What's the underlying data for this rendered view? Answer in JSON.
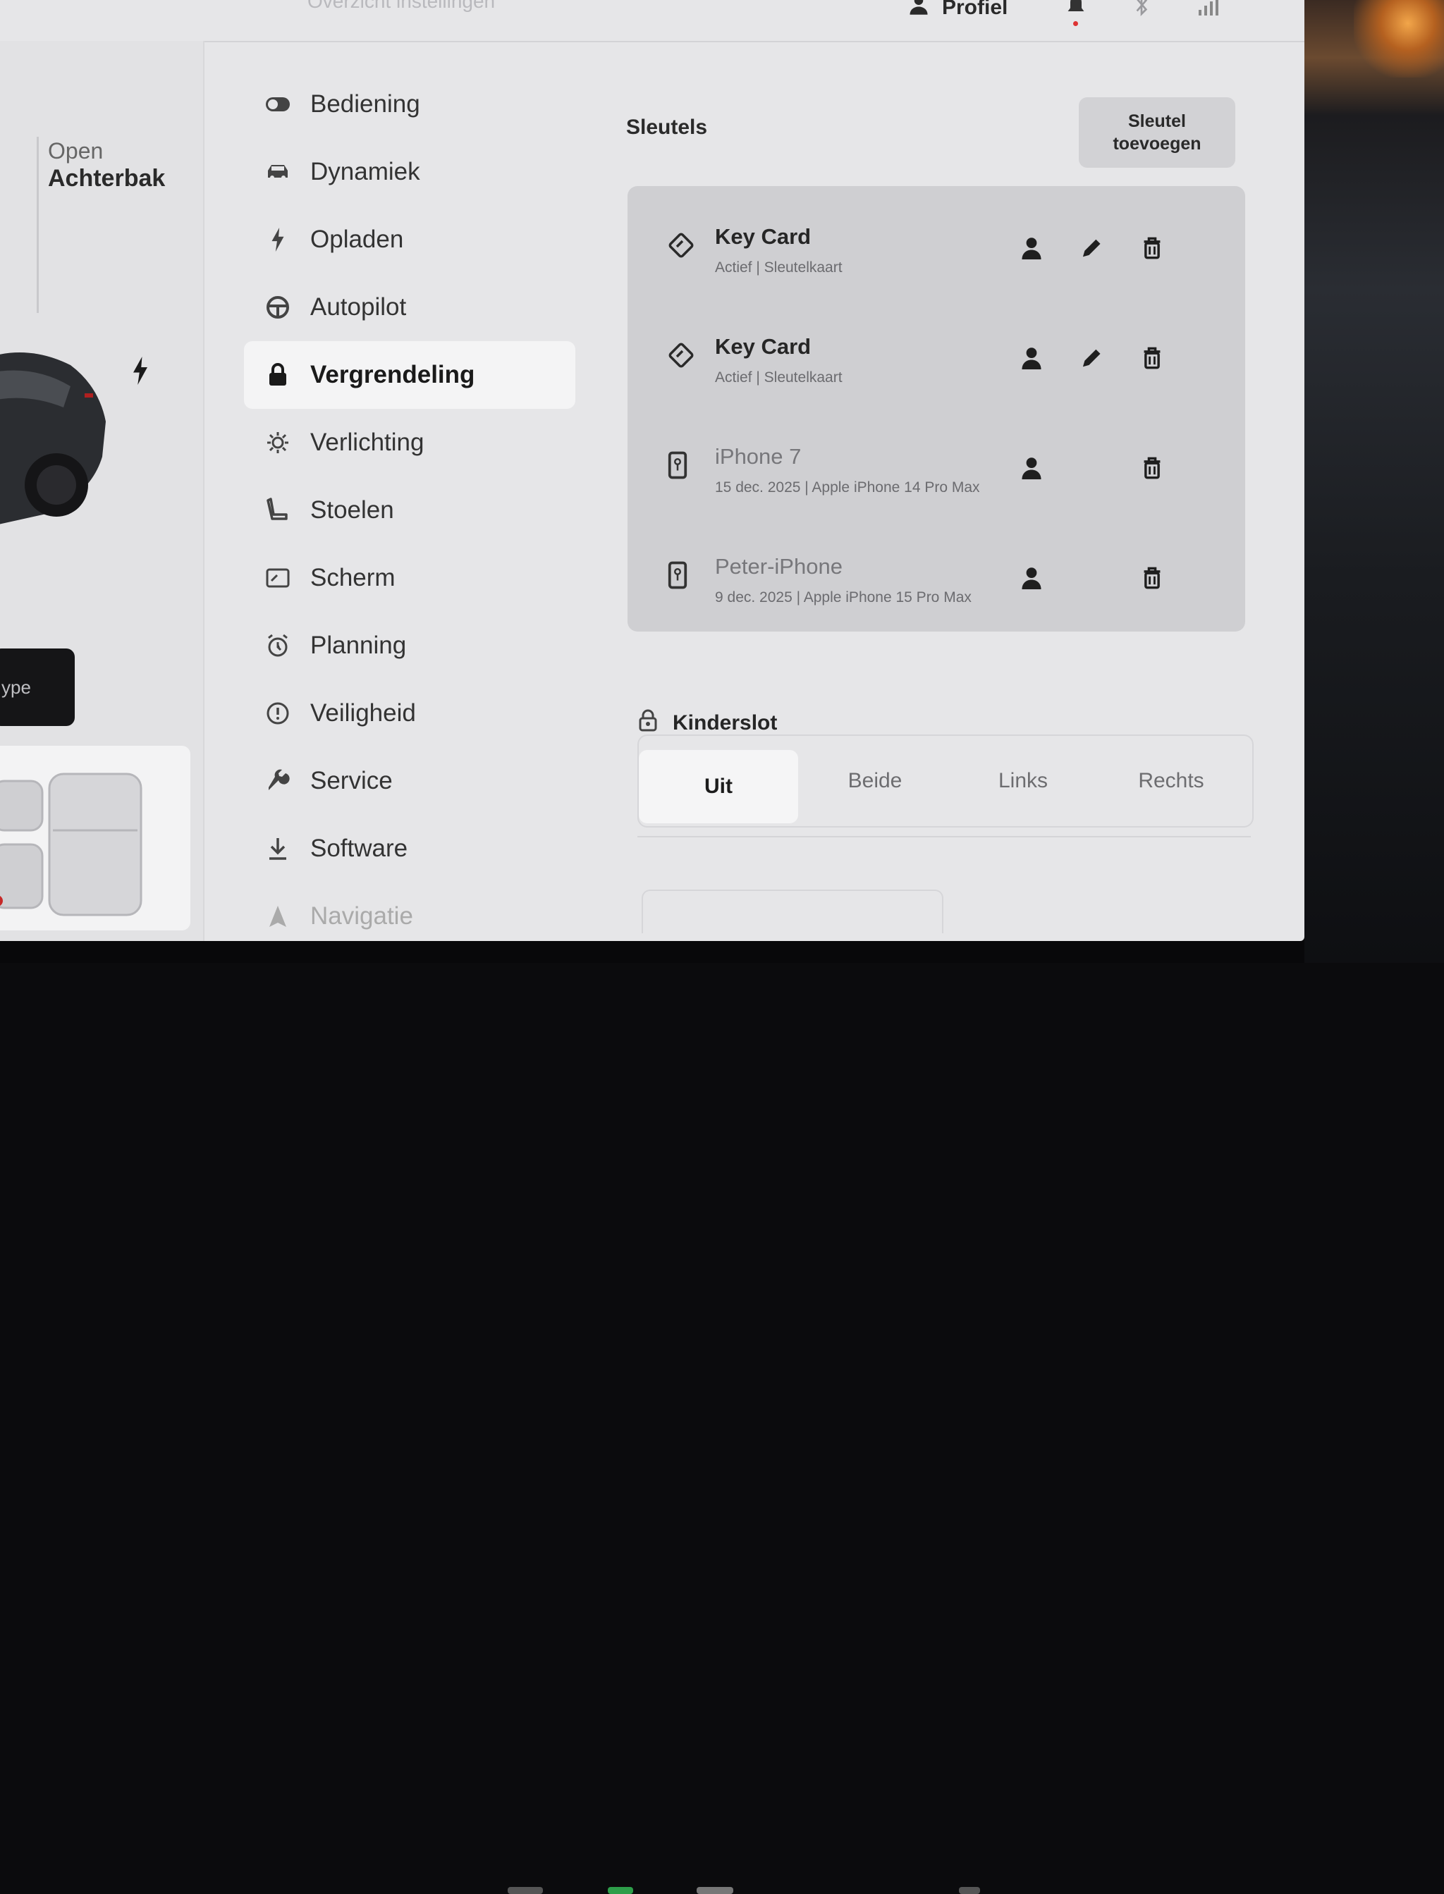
{
  "topbar": {
    "breadcrumb": "Overzicht instellingen",
    "profile_label": "Profiel"
  },
  "car_panel": {
    "open_label": "Open",
    "trunk_label": "Achterbak",
    "type_button_label": "ype"
  },
  "menu": {
    "items": [
      {
        "label": "Bediening",
        "icon": "toggle-icon"
      },
      {
        "label": "Dynamiek",
        "icon": "car-icon"
      },
      {
        "label": "Opladen",
        "icon": "bolt-icon"
      },
      {
        "label": "Autopilot",
        "icon": "steering-wheel-icon"
      },
      {
        "label": "Vergrendeling",
        "icon": "lock-icon",
        "active": true
      },
      {
        "label": "Verlichting",
        "icon": "light-icon"
      },
      {
        "label": "Stoelen",
        "icon": "seat-icon"
      },
      {
        "label": "Scherm",
        "icon": "display-icon"
      },
      {
        "label": "Planning",
        "icon": "alarm-clock-icon"
      },
      {
        "label": "Veiligheid",
        "icon": "alert-circle-icon"
      },
      {
        "label": "Service",
        "icon": "wrench-icon"
      },
      {
        "label": "Software",
        "icon": "download-icon"
      },
      {
        "label": "Navigatie",
        "icon": "navigation-icon"
      }
    ]
  },
  "keys": {
    "title": "Sleutels",
    "add_button_line1": "Sleutel",
    "add_button_line2": "toevoegen",
    "list": [
      {
        "name": "Key Card",
        "subtitle": "Actief | Sleutelkaart",
        "type": "keycard"
      },
      {
        "name": "Key Card",
        "subtitle": "Actief | Sleutelkaart",
        "type": "keycard"
      },
      {
        "name": "iPhone 7",
        "subtitle": "15 dec. 2025 | Apple iPhone 14 Pro Max",
        "type": "phone"
      },
      {
        "name": "Peter-iPhone",
        "subtitle": "9 dec. 2025 | Apple iPhone 15 Pro Max",
        "type": "phone"
      }
    ]
  },
  "child_lock": {
    "title": "Kinderslot",
    "options": [
      "Uit",
      "Beide",
      "Links",
      "Rechts"
    ],
    "selected": "Uit"
  },
  "colors": {
    "screen_bg": "#e6e6e8",
    "panel_bg": "#cfcfd2",
    "active_bg": "#f4f4f5",
    "alert_dot": "#dd3333"
  }
}
